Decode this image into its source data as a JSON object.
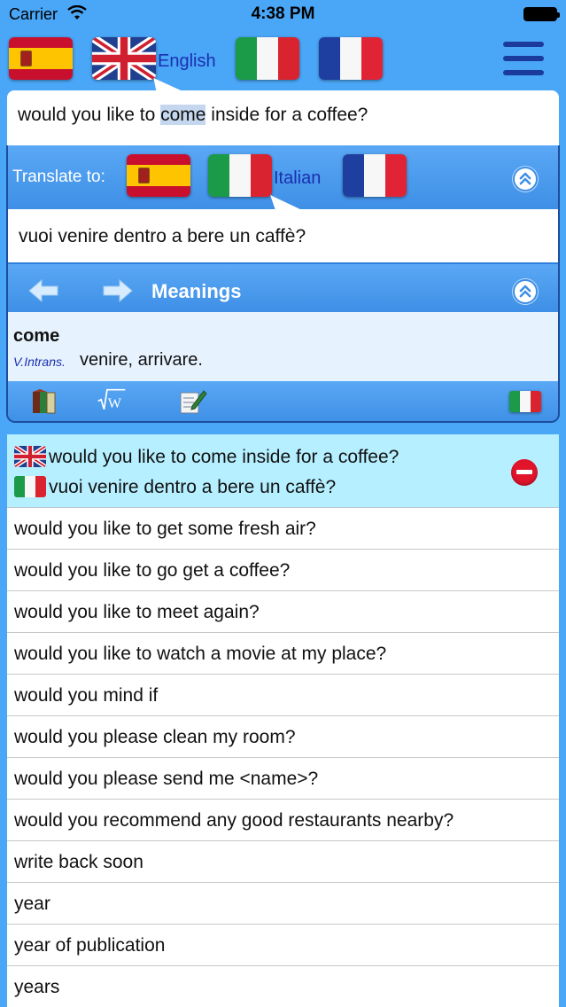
{
  "status_bar": {
    "carrier": "Carrier",
    "time": "4:38 PM"
  },
  "top_bar": {
    "source_language_label": "English",
    "flags": [
      "spanish-flag",
      "uk-flag",
      "italian-flag",
      "french-flag"
    ]
  },
  "source": {
    "before": "would you like to ",
    "highlight": "come",
    "after": " inside for a coffee?"
  },
  "translate": {
    "label": "Translate to:",
    "target_language_label": "Italian",
    "flags": [
      "spanish-flag",
      "italian-flag",
      "french-flag"
    ]
  },
  "target": {
    "text": "vuoi venire dentro a bere un caffè?"
  },
  "meanings": {
    "title": "Meanings",
    "word": "come",
    "part_of_speech": "V.Intrans.",
    "definition": "venire, arrivare."
  },
  "tools": [
    "dictionary-book-icon",
    "wikipedia-icon",
    "edit-note-icon",
    "italian-flag"
  ],
  "history": {
    "current": {
      "source": "would you like to come inside for a coffee?",
      "translation": "vuoi venire dentro a bere un caffè?"
    },
    "items": [
      "would you like to get some fresh air?",
      "would you like to go get a coffee?",
      "would you like to meet again?",
      "would you like to watch a movie at my place?",
      "would you mind if",
      "would you please clean my room?",
      "would you please send me <name>?",
      "would you recommend any good restaurants nearby?",
      "write back soon",
      "year",
      "year of publication",
      "years"
    ]
  },
  "colors": {
    "background": "#4aa6f7",
    "panel_blue": "#3e8fe6",
    "label_blue": "#1a2fb0",
    "current_row": "#b6efff",
    "delete_red": "#e1142b"
  }
}
